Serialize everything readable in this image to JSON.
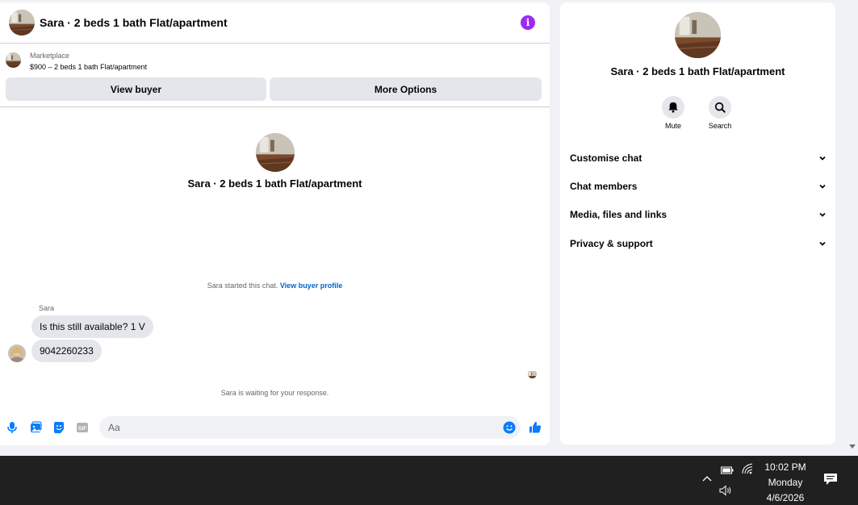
{
  "header": {
    "title": "Sara · 2 beds 1 bath Flat/apartment",
    "info_glyph": "i"
  },
  "listing": {
    "source_label": "Marketplace",
    "price_line": "$900 – 2 beds 1 bath Flat/apartment"
  },
  "actions": {
    "view_buyer": "View buyer",
    "more_options": "More Options"
  },
  "conversation": {
    "title": "Sara · 2 beds 1 bath Flat/apartment",
    "started_text": "Sara started this chat.",
    "started_link": "View buyer profile",
    "sender": "Sara",
    "messages": [
      "Is this still available? 1 V",
      "9042260233"
    ],
    "waiting_text": "Sara is waiting for your response."
  },
  "composer": {
    "placeholder": "Aa",
    "icons": [
      "microphone-icon",
      "photo-icon",
      "sticker-icon",
      "gif-icon",
      "emoji-icon",
      "thumbs-up-icon"
    ],
    "gif_text": "GIF"
  },
  "info_panel": {
    "title": "Sara · 2 beds 1 bath Flat/apartment",
    "mute_label": "Mute",
    "search_label": "Search",
    "sections": [
      "Customise chat",
      "Chat members",
      "Media, files and links",
      "Privacy & support"
    ]
  },
  "taskbar": {
    "time": "10:02 PM",
    "day": "Monday",
    "date": "4/6/2026"
  },
  "colors": {
    "accent": "#0a7cff",
    "info_purple": "#9d2bed",
    "link": "#0064d1",
    "bubble": "#e4e6eb",
    "taskbar": "#202020"
  }
}
